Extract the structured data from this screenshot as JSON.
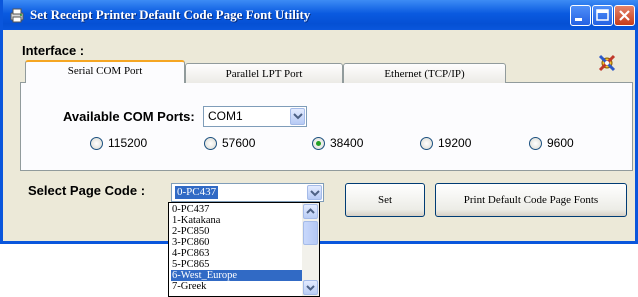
{
  "window": {
    "title": "Set Receipt Printer Default Code Page Font Utility"
  },
  "interface": {
    "label": "Interface :",
    "tabs": [
      {
        "label": "Serial COM Port",
        "active": true
      },
      {
        "label": "Parallel LPT Port",
        "active": false
      },
      {
        "label": "Ethernet (TCP/IP)",
        "active": false
      }
    ]
  },
  "serial": {
    "com_label": "Available COM Ports:",
    "com_value": "COM1",
    "baud_rates": [
      {
        "label": "115200",
        "checked": false
      },
      {
        "label": "57600",
        "checked": false
      },
      {
        "label": "38400",
        "checked": true
      },
      {
        "label": "19200",
        "checked": false
      },
      {
        "label": "9600",
        "checked": false
      }
    ]
  },
  "page_code": {
    "label": "Select Page Code :",
    "selected": "0-PC437",
    "options": [
      "0-PC437",
      "1-Katakana",
      "2-PC850",
      "3-PC860",
      "4-PC863",
      "5-PC865",
      "6-West_Europe",
      "7-Greek"
    ],
    "highlighted": "6-West_Europe"
  },
  "buttons": {
    "set": "Set",
    "print_fonts": "Print Default Code Page Fonts"
  },
  "colors": {
    "titlebar": "#0a56dc",
    "selection": "#316ac5",
    "window_bg": "#ece9d8",
    "active_tab_accent": "#f5a623"
  }
}
